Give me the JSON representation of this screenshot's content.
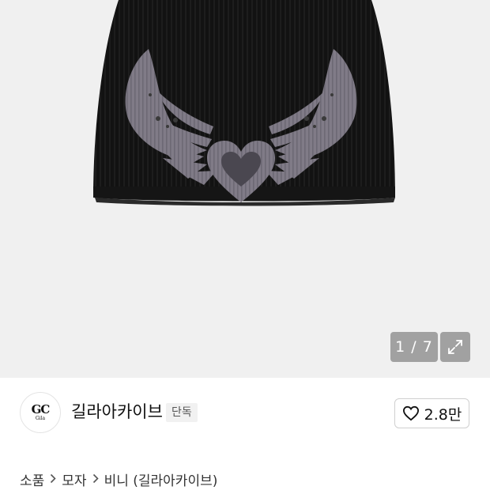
{
  "gallery": {
    "counter": "1 / 7",
    "product_image": "black ribbed beanie with grey winged heart graphic",
    "background_color": "#f0f0f0"
  },
  "store": {
    "logo_mark": "GC",
    "logo_sub": "Gila",
    "name": "길라아카이브",
    "badge": "단독",
    "like_count": "2.8만"
  },
  "breadcrumb": {
    "items": [
      "소품",
      "모자",
      "비니 (길라아카이브)"
    ],
    "separator": "chevron-right-icon"
  },
  "icons": {
    "expand": "expand-icon",
    "like": "heart-outline-icon"
  }
}
